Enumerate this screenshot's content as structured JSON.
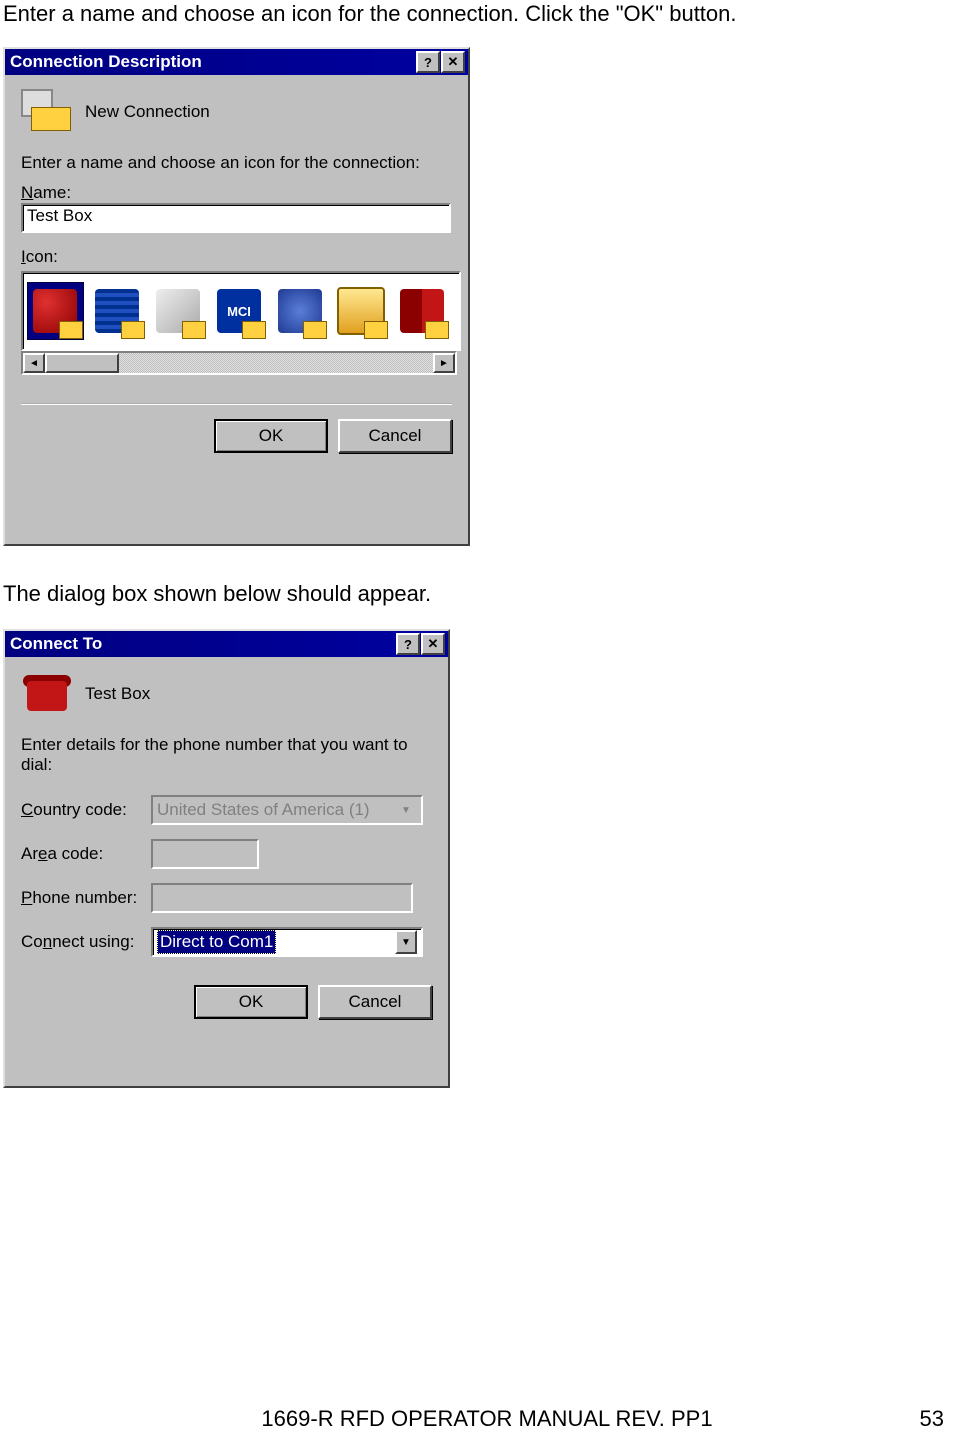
{
  "doc": {
    "intro1": "Enter a name and choose an icon for the connection.  Click the \"OK\" button.",
    "intro2": "The dialog box shown below should appear.",
    "footer": "1669-R RFD OPERATOR MANUAL REV. PP1",
    "page": "53"
  },
  "dialog1": {
    "title": "Connection Description",
    "heading": "New Connection",
    "instruction": "Enter a name and choose an icon for the connection:",
    "name_label": "Name:",
    "name_value": "Test Box",
    "icon_label": "Icon:",
    "mci_text": "MCI",
    "ok": "OK",
    "cancel": "Cancel"
  },
  "dialog2": {
    "title": "Connect To",
    "heading": "Test Box",
    "instruction": "Enter details for the phone number that you want to dial:",
    "country_label": "Country code:",
    "country_value": "United States of America (1)",
    "area_label": "Area code:",
    "area_value": "",
    "phone_label": "Phone number:",
    "phone_value": "",
    "connect_label": "Connect using:",
    "connect_value": "Direct to Com1",
    "ok": "OK",
    "cancel": "Cancel"
  }
}
